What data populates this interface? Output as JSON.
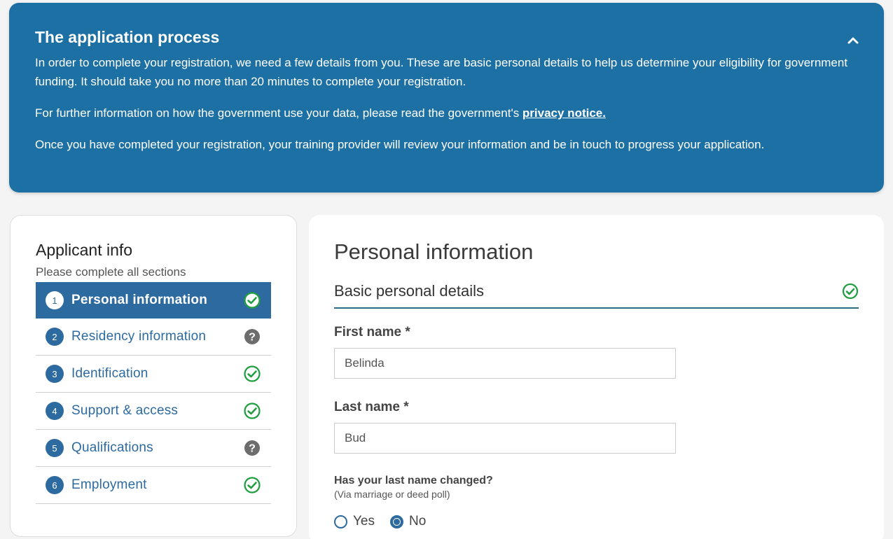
{
  "banner": {
    "title": "The application process",
    "para1": "In order to complete your registration, we need a few details from you. These are basic personal details to help us determine your eligibility for government funding. It should take you no more than 20 minutes to complete your registration.",
    "para2_prefix": "For further information on how the government use your data, please read the government's ",
    "privacy_link": "privacy notice.",
    "para3": "Once you have completed your registration, your training provider will review your information and be in touch to progress your application.",
    "toggle_icon": "chevron-up-icon"
  },
  "sidebar": {
    "title": "Applicant info",
    "subtitle": "Please complete all sections",
    "items": [
      {
        "num": "1",
        "label": "Personal information",
        "status": "complete"
      },
      {
        "num": "2",
        "label": "Residency information",
        "status": "incomplete"
      },
      {
        "num": "3",
        "label": "Identification",
        "status": "complete"
      },
      {
        "num": "4",
        "label": "Support & access",
        "status": "complete"
      },
      {
        "num": "5",
        "label": "Qualifications",
        "status": "incomplete"
      },
      {
        "num": "6",
        "label": "Employment",
        "status": "complete"
      }
    ]
  },
  "main": {
    "title": "Personal information",
    "section_title": "Basic personal details",
    "first_name_label": "First name *",
    "first_name_value": "Belinda",
    "last_name_label": "Last name *",
    "last_name_value": "Bud",
    "name_changed_label": "Has your last name changed?",
    "name_changed_hint": "(Via marriage or deed poll)",
    "options": {
      "yes": "Yes",
      "no": "No"
    },
    "selected": "No"
  },
  "colors": {
    "banner_bg": "#1d70a3",
    "accent": "#2d6a9f",
    "success": "#1e9e3e",
    "help": "#6d6d6d"
  }
}
